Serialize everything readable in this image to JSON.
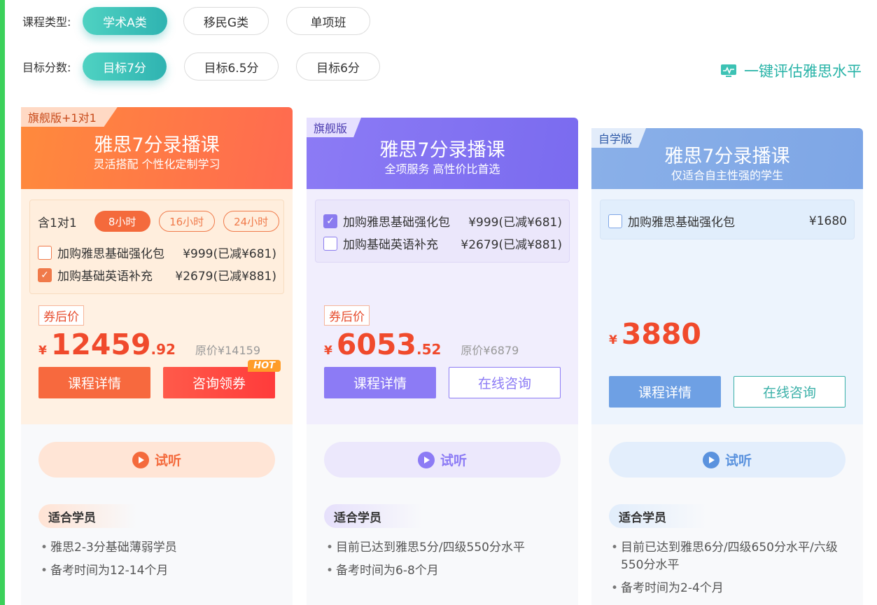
{
  "filters": {
    "type_label": "课程类型:",
    "type_options": [
      "学术A类",
      "移民G类",
      "单项班"
    ],
    "score_label": "目标分数:",
    "score_options": [
      "目标7分",
      "目标6.5分",
      "目标6分"
    ]
  },
  "assess_link": "一键评估雅思水平",
  "colors": {
    "accent_teal": "#2fb3b1",
    "orange": "#ff6a50",
    "purple": "#8a7bef",
    "blue": "#7ea6e6",
    "price_red": "#f04a2c"
  },
  "cards": [
    {
      "tag": "旗舰版+1对1",
      "title": "雅思7分录播课",
      "subtitle": "灵活搭配 个性化定制学习",
      "one_on_one_label": "含1对1",
      "hours": [
        "8小时",
        "16小时",
        "24小时"
      ],
      "addons": [
        {
          "name": "加购雅思基础强化包",
          "price": "¥999(已减¥681)",
          "checked": false
        },
        {
          "name": "加购基础英语补充",
          "price": "¥2679(已减¥881)",
          "checked": true
        }
      ],
      "coupon": "券后价",
      "price_symbol": "¥",
      "price_main": "12459",
      "price_dec": ".92",
      "original": "原价¥14159",
      "btn1": "课程详情",
      "btn2": "咨询领券",
      "hot": "HOT",
      "trial": "试听",
      "fit_title": "适合学员",
      "bullets": [
        "雅思2-3分基础薄弱学员",
        "备考时间为12-14个月"
      ]
    },
    {
      "tag": "旗舰版",
      "title": "雅思7分录播课",
      "subtitle": "全项服务 高性价比首选",
      "addons": [
        {
          "name": "加购雅思基础强化包",
          "price": "¥999(已减¥681)",
          "checked": true
        },
        {
          "name": "加购基础英语补充",
          "price": "¥2679(已减¥881)",
          "checked": false
        }
      ],
      "coupon": "券后价",
      "price_symbol": "¥",
      "price_main": "6053",
      "price_dec": ".52",
      "original": "原价¥6879",
      "btn1": "课程详情",
      "btn2": "在线咨询",
      "trial": "试听",
      "fit_title": "适合学员",
      "bullets": [
        "目前已达到雅思5分/四级550分水平",
        "备考时间为6-8个月"
      ]
    },
    {
      "tag": "自学版",
      "title": "雅思7分录播课",
      "subtitle": "仅适合自主性强的学生",
      "addons": [
        {
          "name": "加购雅思基础强化包",
          "price": "¥1680",
          "checked": false
        }
      ],
      "price_symbol": "¥",
      "price_main": "3880",
      "btn1": "课程详情",
      "btn2": "在线咨询",
      "trial": "试听",
      "fit_title": "适合学员",
      "bullets": [
        "目前已达到雅思6分/四级650分水平/六级550分水平",
        "备考时间为2-4个月"
      ]
    }
  ]
}
